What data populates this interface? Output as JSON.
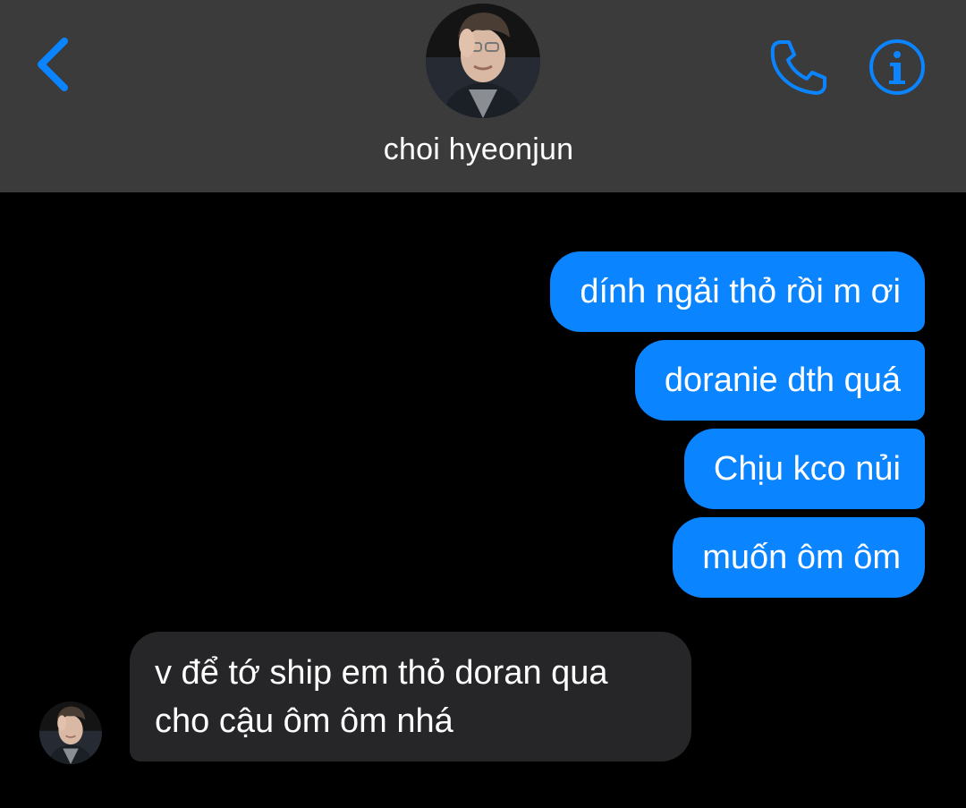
{
  "header": {
    "contact_name": "choi hyeonjun",
    "back_icon": "chevron-left-icon",
    "call_icon": "phone-icon",
    "info_icon": "info-icon",
    "accent_color": "#0a84ff",
    "background_color": "#3b3b3b"
  },
  "messages": {
    "outgoing": [
      "dính ngải thỏ rồi m ơi",
      "doranie dth quá",
      "Chịu kco nủi",
      "muốn ôm ôm"
    ],
    "incoming": [
      {
        "line1": "v để tớ ship em thỏ doran qua",
        "line2": "cho cậu ôm ôm nhá"
      }
    ],
    "outgoing_color": "#0a84ff",
    "incoming_color": "#262629"
  }
}
